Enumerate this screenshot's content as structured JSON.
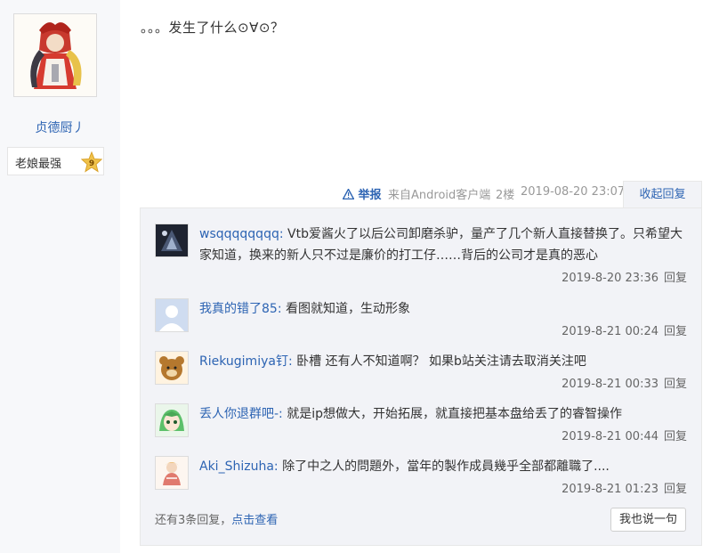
{
  "user": {
    "name": "贞德厨丿",
    "badge_label": "老娘最强",
    "badge_level": "9"
  },
  "post": {
    "content": "。。。发生了什么⊙∀⊙？",
    "report_label": "举报",
    "source": "来自Android客户端",
    "floor": "2楼",
    "date": "2019-08-20 23:07",
    "collapse_label": "收起回复"
  },
  "replies": [
    {
      "user": "wsqqqqqqqq:",
      "text": " Vtb爱酱火了以后公司卸磨杀驴，量产了几个新人直接替换了。只希望大家知道，换来的新人只不过是廉价的打工仔……背后的公司才是真的恶心",
      "time": "2019-8-20 23:36",
      "reply_label": "回复"
    },
    {
      "user": "我真的错了85:",
      "text": " 看图就知道，生动形象",
      "time": "2019-8-21 00:24",
      "reply_label": "回复"
    },
    {
      "user": "Riekugimiya钉:",
      "text": " 卧槽 还有人不知道啊？ 如果b站关注请去取消关注吧",
      "time": "2019-8-21 00:33",
      "reply_label": "回复"
    },
    {
      "user": "丢人你退群吧-:",
      "text": " 就是ip想做大，开始拓展，就直接把基本盘给丢了的睿智操作",
      "time": "2019-8-21 00:44",
      "reply_label": "回复"
    },
    {
      "user": "Aki_Shizuha:",
      "text": " 除了中之人的問題外，當年的製作成員幾乎全部都離職了....",
      "time": "2019-8-21 01:23",
      "reply_label": "回复"
    }
  ],
  "more": {
    "prefix": "还有3条回复，",
    "link": "点击查看"
  },
  "say_button": "我也说一句"
}
